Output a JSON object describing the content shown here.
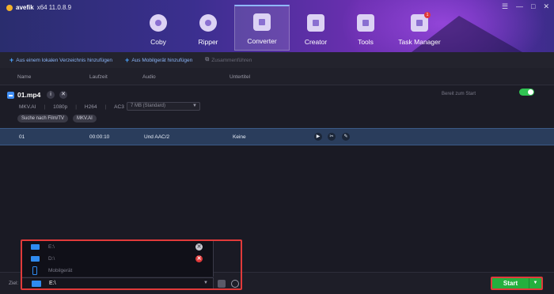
{
  "app": {
    "brand": "avefik",
    "version": "x64  11.0.8.9"
  },
  "window_controls": [
    "☰",
    "—",
    "□",
    "✕"
  ],
  "nav": {
    "tabs": [
      {
        "label": "Coby",
        "icon": "disc-copy-icon",
        "active": false
      },
      {
        "label": "Ripper",
        "icon": "disc-ripper-icon",
        "active": false
      },
      {
        "label": "Converter",
        "icon": "converter-icon",
        "active": true
      },
      {
        "label": "Creator",
        "icon": "creator-icon",
        "active": false
      },
      {
        "label": "Tools",
        "icon": "tools-icon",
        "active": false
      },
      {
        "label": "Task Manager",
        "icon": "task-manager-icon",
        "active": false,
        "badge": "1"
      }
    ]
  },
  "toolbar": {
    "add_local": "Aus einem lokalen Verzeichnis hinzufügen",
    "add_mobile": "Aus Mobilgerät hinzufügen",
    "merge": "Zusammenführen"
  },
  "columns": {
    "name": "Name",
    "duration": "Laufzeit",
    "audio": "Audio",
    "subtitle": "Untertitel"
  },
  "file": {
    "name": "01.mp4",
    "meta": [
      "MKV.AI",
      "1080p",
      "H264",
      "AC3"
    ],
    "size_select": "7 MB (Standard)",
    "pills": [
      "Suche nach Film/TV",
      "MKV.AI"
    ],
    "status": "Bereit zum Start",
    "toggle_on": true
  },
  "track": {
    "title": "01",
    "duration": "00:00:10",
    "audio": "Und  AAC/2",
    "subtitle": "Keine"
  },
  "bottom": {
    "target_label": "Ziel:",
    "target_value": "E:\\",
    "start_label": "Start"
  },
  "drives": [
    {
      "label": "E:\\",
      "icon": "folder-icon",
      "action": "grey"
    },
    {
      "label": "D:\\",
      "icon": "folder-icon",
      "action": "red"
    },
    {
      "label": "Mobilgerät",
      "icon": "phone-icon",
      "action": ""
    }
  ],
  "colors": {
    "accent": "#3f8ef5",
    "start_green": "#24b03e",
    "highlight_red": "#e13a3a",
    "track_row": "#2a3d5c"
  }
}
